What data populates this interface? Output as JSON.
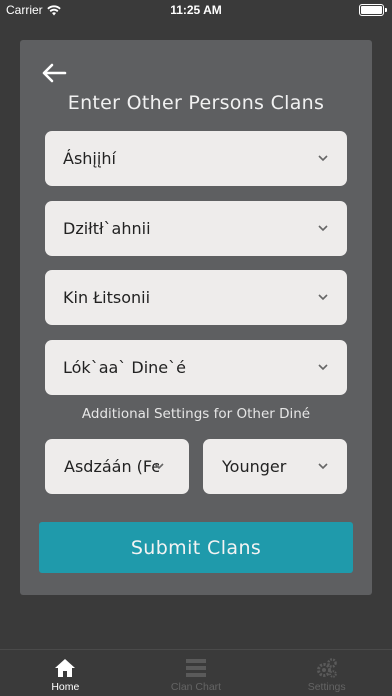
{
  "status_bar": {
    "carrier": "Carrier",
    "time": "11:25 AM"
  },
  "form": {
    "title": "Enter Other Persons Clans",
    "clans": [
      {
        "value": "Áshįįhí"
      },
      {
        "value": "Dziłtł`ahnii"
      },
      {
        "value": "Kin Łitsonii"
      },
      {
        "value": "Lók`aa` Dine`é"
      }
    ],
    "additional_label": "Additional Settings for Other Diné",
    "gender": {
      "value": "Asdzáán (Female)"
    },
    "age": {
      "value": "Younger"
    },
    "submit_label": "Submit Clans"
  },
  "tabbar": {
    "tabs": [
      {
        "label": "Home",
        "icon": "home-icon",
        "active": true
      },
      {
        "label": "Clan Chart",
        "icon": "list-icon",
        "active": false
      },
      {
        "label": "Settings",
        "icon": "gears-icon",
        "active": false
      }
    ]
  },
  "colors": {
    "background": "#3a3a3a",
    "card": "#5e5f61",
    "select": "#eeeceb",
    "accent": "#1f9aab"
  }
}
